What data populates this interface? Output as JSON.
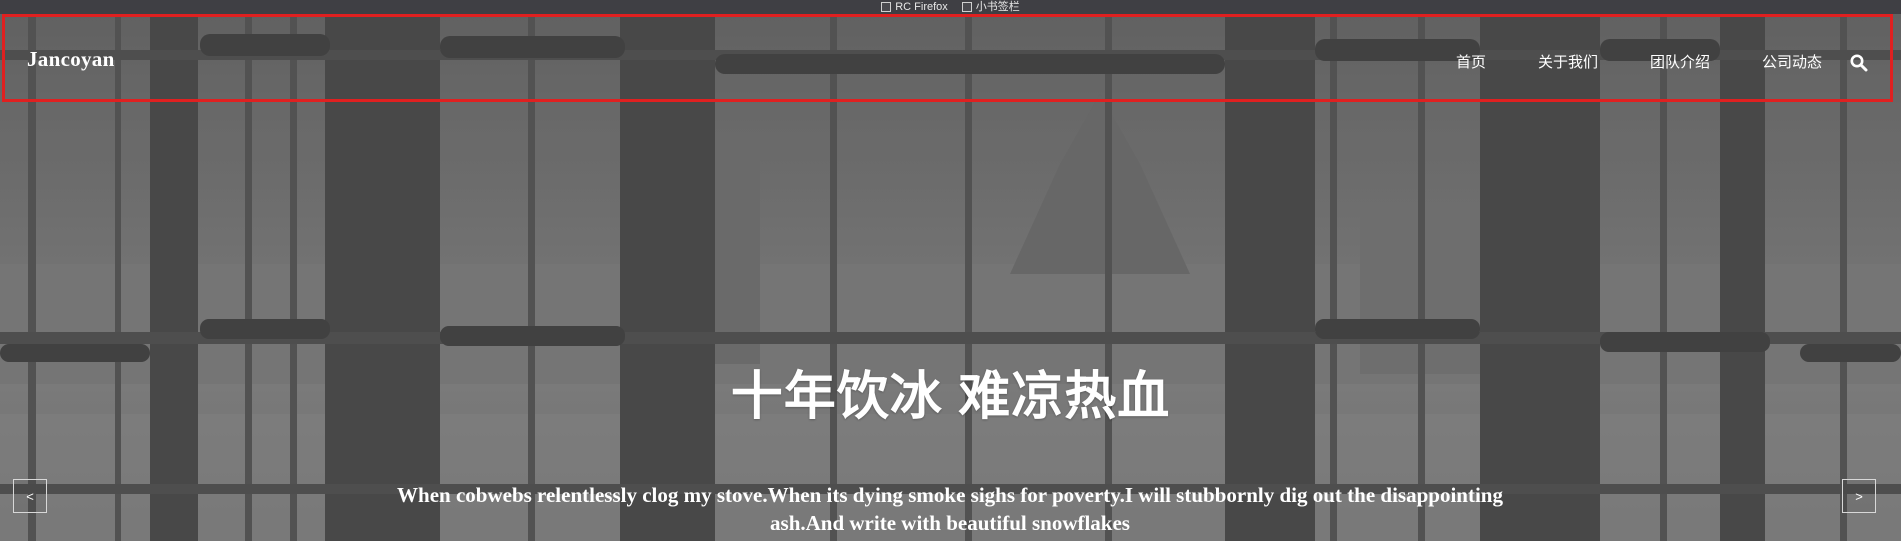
{
  "bookmarks_bar": {
    "items": [
      {
        "label": "RC Firefox"
      },
      {
        "label": "小书签栏"
      }
    ]
  },
  "navbar": {
    "brand": "Jancoyan",
    "links": [
      {
        "label": "首页"
      },
      {
        "label": "关于我们"
      },
      {
        "label": "团队介绍"
      },
      {
        "label": "公司动态"
      }
    ],
    "search_icon": "search-icon",
    "highlight_color": "#e02020"
  },
  "hero": {
    "title": "十年饮冰 难凉热血",
    "subtitle": "When cobwebs relentlessly clog my stove.When its dying smoke sighs for poverty.I will stubbornly dig out the disappointing ash.And write with beautiful snowflakes",
    "prev_label": "<",
    "next_label": ">"
  }
}
